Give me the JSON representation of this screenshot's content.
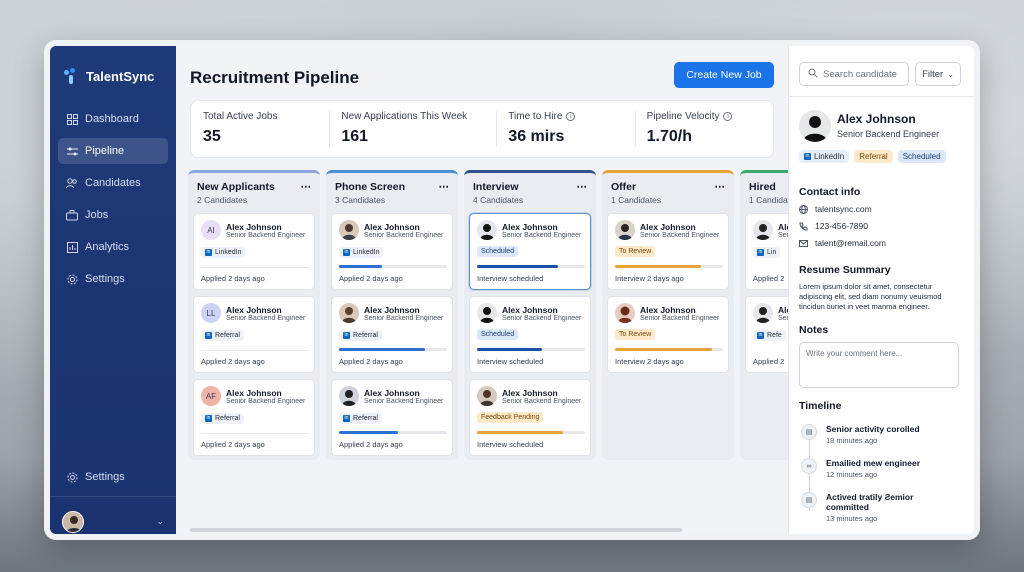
{
  "app": {
    "name": "TalentSync"
  },
  "sidebar": {
    "items": [
      {
        "label": "Dashboard",
        "icon": "grid-icon"
      },
      {
        "label": "Pipeline",
        "icon": "sliders-icon"
      },
      {
        "label": "Candidates",
        "icon": "users-icon"
      },
      {
        "label": "Jobs",
        "icon": "briefcase-icon"
      },
      {
        "label": "Analytics",
        "icon": "bar-chart-icon"
      },
      {
        "label": "Settings",
        "icon": "gear-icon"
      }
    ],
    "bottom_settings": "Settings"
  },
  "header": {
    "title": "Recruitment Pipeline",
    "create_button": "Create New Job"
  },
  "stats": [
    {
      "label": "Total Active Jobs",
      "value": "35"
    },
    {
      "label": "New Applications This Week",
      "value": "161"
    },
    {
      "label": "Time to Hire",
      "value": "36 mirs"
    },
    {
      "label": "Pipeline Velocity",
      "value": "1.70/h"
    }
  ],
  "columns": [
    {
      "title": "New Applicants",
      "count": "2 Candidates",
      "accent": "#8aa7e0",
      "cards": [
        {
          "name": "Alex Johnson",
          "role": "Senior Backend Engineer",
          "tag": "LinkedIn",
          "initials": "AI",
          "footer": "Applied 2 days ago"
        },
        {
          "name": "Alex Johnson",
          "role": "Senior Backend Engineer",
          "tag": "Referral",
          "initials": "LL",
          "footer": "Applied 2 days ago"
        },
        {
          "name": "Alex Johnson",
          "role": "Senior Backend Engineer",
          "tag": "Referral",
          "initials": "AF",
          "footer": "Applied 2 days ago"
        }
      ]
    },
    {
      "title": "Phone Screen",
      "count": "3 Candidates",
      "accent": "#4a90d9",
      "cards": [
        {
          "name": "Alex Johnson",
          "role": "Senior Backend Engineer",
          "tag": "LinkedIn",
          "footer": "Applied 2 days ago",
          "progress": 0.4
        },
        {
          "name": "Alex Johnson",
          "role": "Senior Backend Engineer",
          "tag": "Referral",
          "footer": "Applied 2 days ago",
          "progress": 0.8
        },
        {
          "name": "Alex Johnson",
          "role": "Senior Backend Engineer",
          "tag": "Referral",
          "footer": "Applied 2 days ago",
          "progress": 0.55
        }
      ]
    },
    {
      "title": "Interview",
      "count": "4 Candidates",
      "accent": "#2f4f8f",
      "cards": [
        {
          "name": "Alex Johnson",
          "role": "Senior Backend Engineer",
          "tag": "Scheduled",
          "footer": "Interview scheduled",
          "progress": 0.75
        },
        {
          "name": "Alex Johnson",
          "role": "Senior Backend Engineer",
          "tag": "Scheduled",
          "footer": "Interview scheduled",
          "progress": 0.6
        },
        {
          "name": "Alex Johnson",
          "role": "Senior Backend Engineer",
          "tag": "Feedback Pending",
          "footer": "Interview scheduled",
          "progress": 0.8
        }
      ]
    },
    {
      "title": "Offer",
      "count": "1 Candidates",
      "accent": "#e8a23a",
      "cards": [
        {
          "name": "Alex Johnson",
          "role": "Senior Backend Engineer",
          "tag": "To Review",
          "footer": "Interview 2 days ago",
          "progress": 0.8
        },
        {
          "name": "Alex Johnson",
          "role": "Senior Backend Engineer",
          "tag": "To Review",
          "footer": "Interview 2 days ago",
          "progress": 0.9
        }
      ]
    },
    {
      "title": "Hired",
      "count": "1 Candidat",
      "accent": "#3aa76d",
      "cards": [
        {
          "name": "Ale",
          "role": "Sen",
          "tag": "Lin",
          "footer": "Applied 2"
        },
        {
          "name": "Ale",
          "role": "Sen",
          "tag": "Refe",
          "footer": "Applied 2"
        }
      ]
    }
  ],
  "detail": {
    "search_placeholder": "Search candidate",
    "filter_label": "Filter",
    "name": "Alex Johnson",
    "role": "Senior Backend Engineer",
    "tags": [
      "LinkedIn",
      "Referral",
      "Scheduled"
    ],
    "contact_title": "Contact info",
    "contact": [
      {
        "icon": "globe-icon",
        "text": "talentsync.com"
      },
      {
        "icon": "phone-icon",
        "text": "123-456-7890"
      },
      {
        "icon": "mail-icon",
        "text": "talent@remail.com"
      }
    ],
    "summary_title": "Resume Summary",
    "summary": "Lorem ipsum dolor sit amet, consectetur adipiscing elit, sed diam nonumy veuismod tincidun tiuriet in veet manma engineer.",
    "notes_title": "Notes",
    "notes_placeholder": "Write your comment here...",
    "timeline_title": "Timeline",
    "timeline": [
      {
        "text": "Senior activity corolled",
        "time": "18 minutes ago"
      },
      {
        "text": "Emailied mew engineer",
        "time": "12 minutes ago"
      },
      {
        "text": "Actived tratily Ƨemior committed",
        "time": "13 minutes ago"
      }
    ]
  }
}
